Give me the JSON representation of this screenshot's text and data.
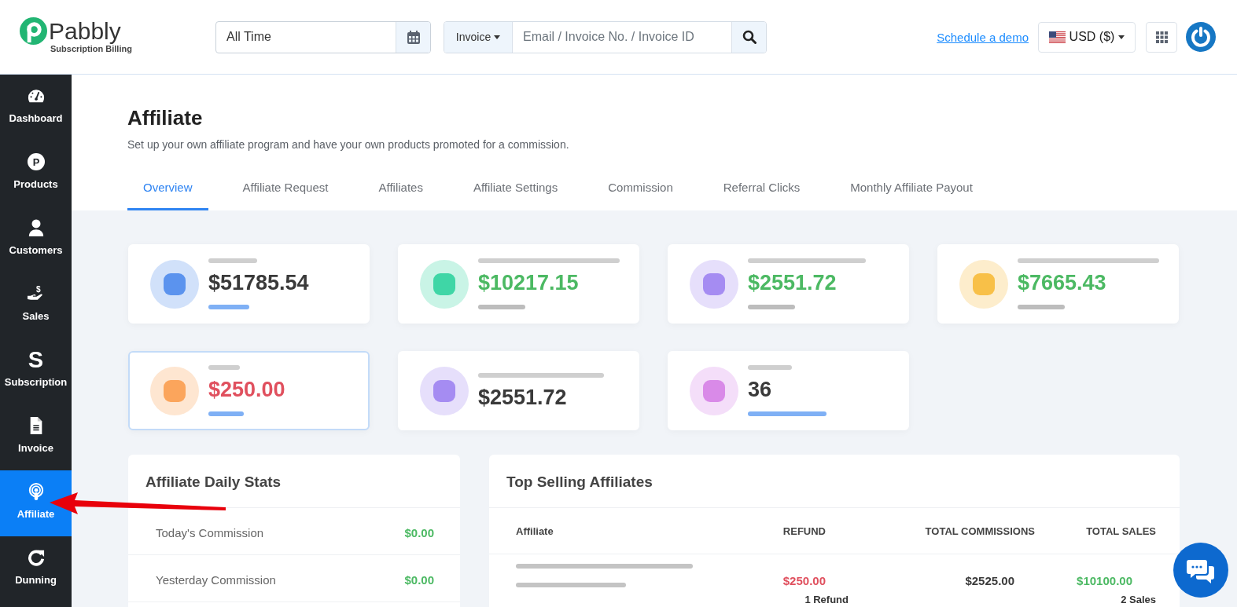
{
  "header": {
    "logo": {
      "name": "Pabbly",
      "tagline": "Subscription Billing"
    },
    "date_filter": {
      "value": "All Time"
    },
    "search": {
      "scope": "Invoice",
      "placeholder": "Email / Invoice No. / Invoice ID"
    },
    "demo_link": "Schedule a demo",
    "currency": "USD ($)"
  },
  "sidebar": {
    "items": [
      {
        "label": "Dashboard",
        "selected": false
      },
      {
        "label": "Products",
        "glyph": "P",
        "selected": false
      },
      {
        "label": "Customers",
        "selected": false
      },
      {
        "label": "Sales",
        "glyph": "$",
        "selected": false
      },
      {
        "label": "Subscription",
        "glyph": "S",
        "selected": false
      },
      {
        "label": "Invoice",
        "selected": false
      },
      {
        "label": "Affiliate",
        "selected": true
      },
      {
        "label": "Dunning",
        "selected": false
      }
    ]
  },
  "page": {
    "title": "Affiliate",
    "subtitle": "Set up your own affiliate program and have your own products promoted for a commission.",
    "tabs": [
      {
        "label": "Overview",
        "selected": true
      },
      {
        "label": "Affiliate Request",
        "selected": false
      },
      {
        "label": "Affiliates",
        "selected": false
      },
      {
        "label": "Affiliate Settings",
        "selected": false
      },
      {
        "label": "Commission",
        "selected": false
      },
      {
        "label": "Referral Clicks",
        "selected": false
      },
      {
        "label": "Monthly Affiliate Payout",
        "selected": false
      }
    ]
  },
  "stat_cards": [
    {
      "color": "#5b93ee",
      "amount": {
        "text": "$51785.54",
        "color": "#3a3a3a"
      },
      "caption_bar": {
        "color": "#7fb0f5"
      },
      "highlighted": false
    },
    {
      "color": "#3fd6a6",
      "amount": {
        "text": "$10217.15",
        "color": "#4cb963"
      },
      "caption_bar": {
        "color": "#bdbdbd"
      },
      "highlighted": false
    },
    {
      "color": "#a58cf2",
      "amount": {
        "text": "$2551.72",
        "color": "#4cb963"
      },
      "caption_bar": {
        "color": "#bdbdbd"
      },
      "highlighted": false
    },
    {
      "color": "#f8c048",
      "amount": {
        "text": "$7665.43",
        "color": "#4cb963"
      },
      "caption_bar": {
        "color": "#bdbdbd"
      },
      "highlighted": false
    },
    {
      "color": "#fba55c",
      "amount": {
        "text": "$250.00",
        "color": "#e0505e"
      },
      "caption_bar": {
        "color": "#7fb0f5"
      },
      "highlighted": true
    },
    {
      "color": "#a58cf2",
      "amount": {
        "text": "$2551.72",
        "color": "#3a3a3a"
      },
      "highlighted": false
    },
    {
      "color": "#d98ae8",
      "amount": {
        "text": "36",
        "color": "#3a3a3a"
      },
      "caption_bar": {
        "color": "#7fb0f5"
      },
      "highlighted": false
    }
  ],
  "daily_stats": {
    "title": "Affiliate Daily Stats",
    "rows": [
      {
        "label": "Today's Commission",
        "value": "$0.00"
      },
      {
        "label": "Yesterday Commission",
        "value": "$0.00"
      }
    ]
  },
  "top_affiliates": {
    "title": "Top Selling Affiliates",
    "columns": [
      "Affiliate",
      "REFUND",
      "TOTAL COMMISSIONS",
      "TOTAL SALES"
    ],
    "rows": [
      {
        "refund": "$250.00",
        "refund_note": "1 Refund",
        "commission": "$2525.00",
        "sales": "$10100.00",
        "sales_note": "2 Sales"
      }
    ]
  },
  "annotations": [
    {
      "kind": "arrow"
    }
  ]
}
